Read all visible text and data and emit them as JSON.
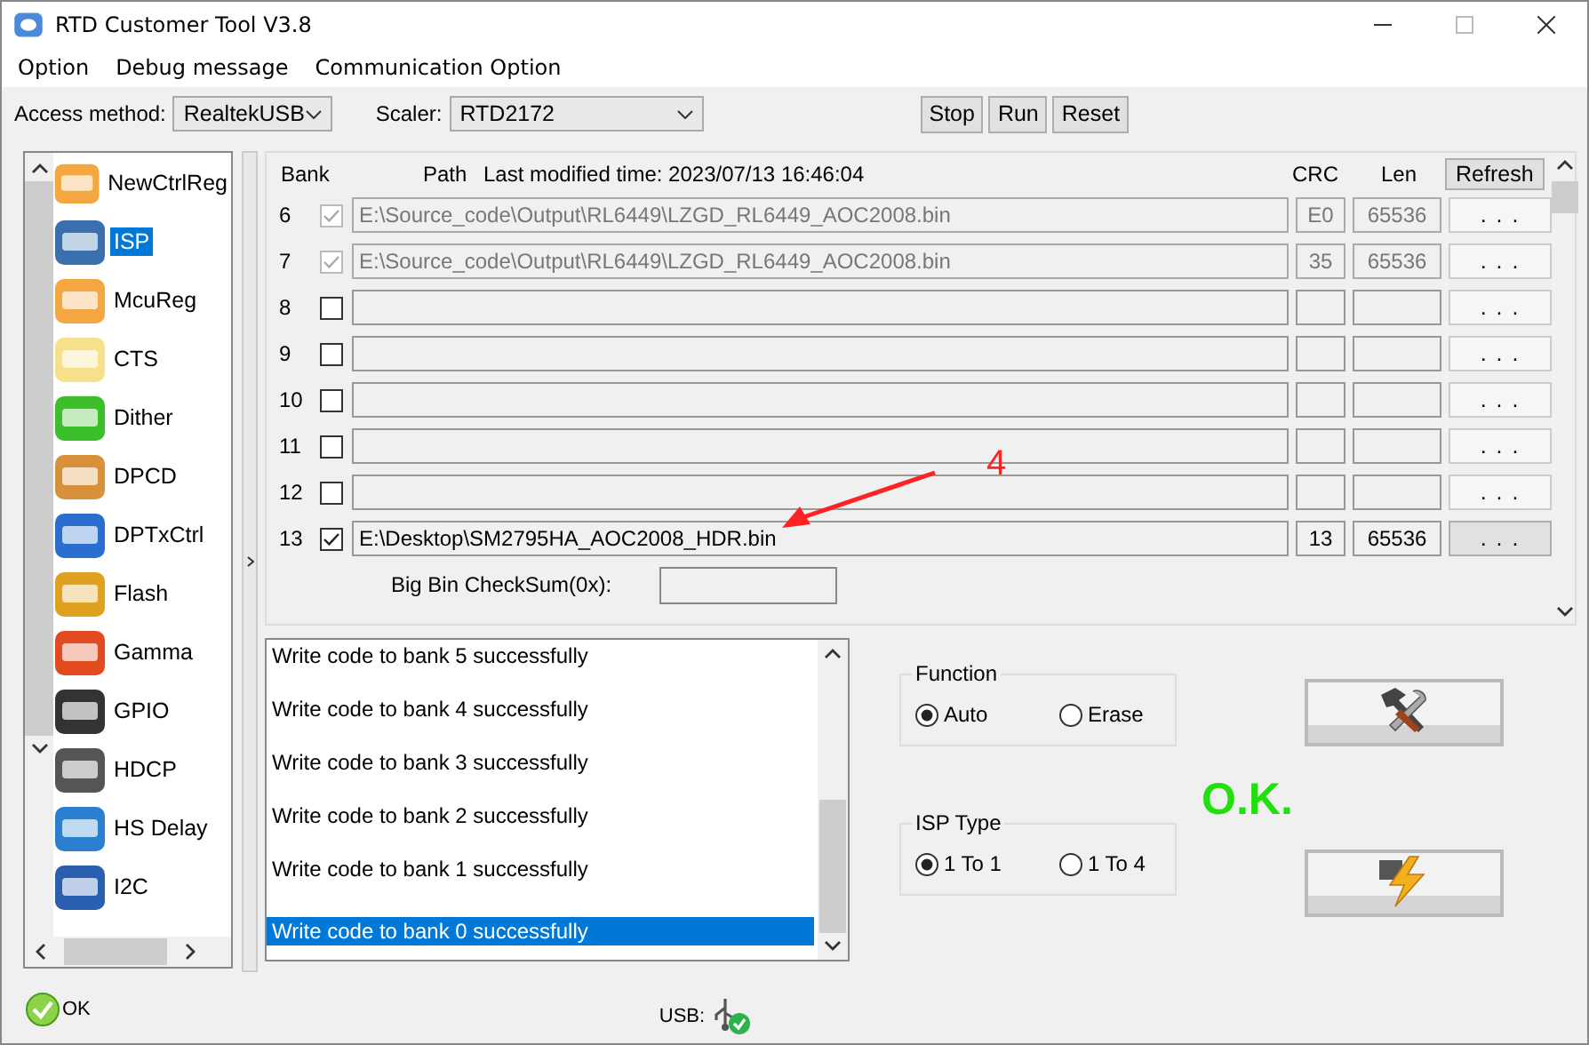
{
  "window": {
    "title": "RTD Customer Tool V3.8"
  },
  "menu": [
    "Option",
    "Debug message",
    "Communication Option"
  ],
  "toolbar": {
    "access_method": {
      "label": "Access method:",
      "value": "RealtekUSB"
    },
    "scaler": {
      "label": "Scaler:",
      "value": "RTD2172"
    },
    "buttons": [
      "Stop",
      "Run",
      "Reset"
    ]
  },
  "sidebar": {
    "items": [
      {
        "label": "NewCtrlReg",
        "selected": false
      },
      {
        "label": "ISP",
        "selected": true
      },
      {
        "label": "McuReg",
        "selected": false
      },
      {
        "label": "CTS",
        "selected": false
      },
      {
        "label": "Dither",
        "selected": false
      },
      {
        "label": "DPCD",
        "selected": false
      },
      {
        "label": "DPTxCtrl",
        "selected": false
      },
      {
        "label": "Flash",
        "selected": false
      },
      {
        "label": "Gamma",
        "selected": false
      },
      {
        "label": "GPIO",
        "selected": false
      },
      {
        "label": "HDCP",
        "selected": false
      },
      {
        "label": "HS Delay",
        "selected": false
      },
      {
        "label": "I2C",
        "selected": false
      }
    ]
  },
  "banks": {
    "headers": {
      "bank": "Bank",
      "path": "Path",
      "modified": "Last modified time: 2023/07/13 16:46:04",
      "crc": "CRC",
      "len": "Len"
    },
    "refresh_button": "Refresh",
    "rows": [
      {
        "bank": "6",
        "checked": true,
        "disabled": true,
        "path": "E:\\Source_code\\Output\\RL6449\\LZGD_RL6449_AOC2008.bin",
        "crc": "E0",
        "len": "65536",
        "button": ". . ."
      },
      {
        "bank": "7",
        "checked": true,
        "disabled": true,
        "path": "E:\\Source_code\\Output\\RL6449\\LZGD_RL6449_AOC2008.bin",
        "crc": "35",
        "len": "65536",
        "button": ". . ."
      },
      {
        "bank": "8",
        "checked": false,
        "disabled": false,
        "button": ". . ."
      },
      {
        "bank": "9",
        "checked": false,
        "disabled": false,
        "button": ". . ."
      },
      {
        "bank": "10",
        "checked": false,
        "disabled": false,
        "button": ". . ."
      },
      {
        "bank": "11",
        "checked": false,
        "disabled": false,
        "button": ". . ."
      },
      {
        "bank": "12",
        "checked": false,
        "disabled": false,
        "button": ". . ."
      },
      {
        "bank": "13",
        "checked": true,
        "disabled": false,
        "path": "E:\\Desktop\\SM2795HA_AOC2008_HDR.bin",
        "crc": "13",
        "len": "65536",
        "button": ". . ."
      }
    ],
    "checksum_label": "Big Bin CheckSum(0x):"
  },
  "log": {
    "lines": [
      {
        "text": "Write code to bank 5 successfully",
        "selected": false
      },
      {
        "text": "Write code to bank 4 successfully",
        "selected": false
      },
      {
        "text": "Write code to bank 3 successfully",
        "selected": false
      },
      {
        "text": "Write code to bank 2 successfully",
        "selected": false
      },
      {
        "text": "Write code to bank 1 successfully",
        "selected": false
      },
      {
        "text": "Write code to bank 0 successfully",
        "selected": true
      }
    ]
  },
  "function": {
    "title": "Function",
    "options": [
      {
        "label": "Auto",
        "selected": true
      },
      {
        "label": "Erase",
        "selected": false
      }
    ]
  },
  "isp_type": {
    "title": "ISP Type",
    "options": [
      {
        "label": "1 To 1",
        "selected": true
      },
      {
        "label": "1 To 4",
        "selected": false
      }
    ]
  },
  "result": "O.K.",
  "status_bar": {
    "ok_label": "OK",
    "usb_label": "USB:"
  },
  "annotation": {
    "label": "4"
  }
}
